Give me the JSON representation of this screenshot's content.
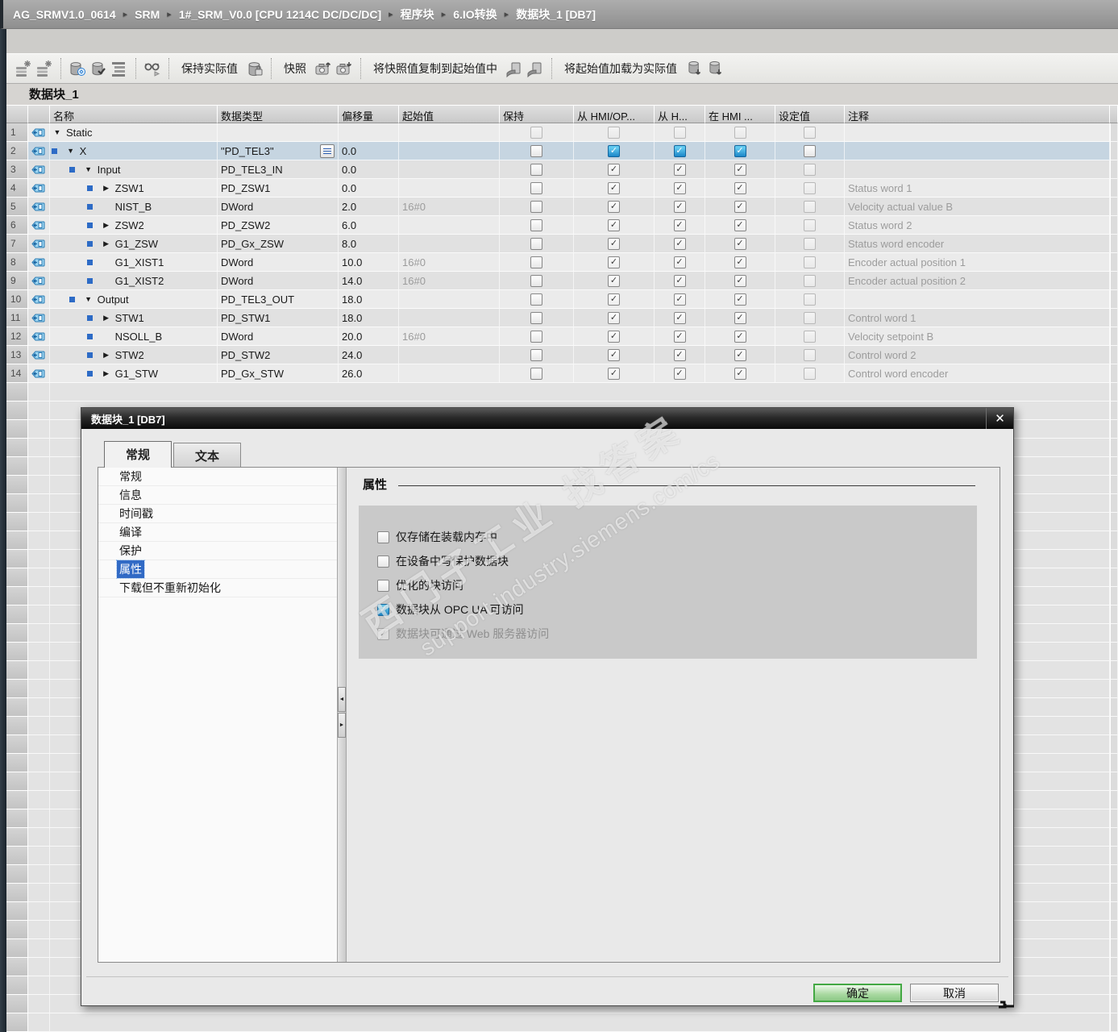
{
  "breadcrumb": {
    "items": [
      "AG_SRMV1.0_0614",
      "SRM",
      "1#_SRM_V0.0 [CPU 1214C DC/DC/DC]",
      "程序块",
      "6.IO转换",
      "数据块_1 [DB7]"
    ],
    "separator": "▸"
  },
  "toolbar": {
    "items": [
      {
        "type": "icon",
        "name": "insert-row-icon"
      },
      {
        "type": "icon",
        "name": "insert-row-below-icon"
      },
      {
        "type": "sep"
      },
      {
        "type": "icon",
        "name": "db-update-icon"
      },
      {
        "type": "icon",
        "name": "db-accept-icon"
      },
      {
        "type": "icon",
        "name": "outline-view-icon"
      },
      {
        "type": "sep"
      },
      {
        "type": "icon",
        "name": "monitor-glasses-icon"
      },
      {
        "type": "sep"
      },
      {
        "type": "button",
        "name": "retain-actual-values-button",
        "label": "保持实际值"
      },
      {
        "type": "icon",
        "name": "db-retain-icon"
      },
      {
        "type": "sep"
      },
      {
        "type": "button",
        "name": "snapshot-button",
        "label": "快照"
      },
      {
        "type": "icon",
        "name": "camera-up-icon"
      },
      {
        "type": "icon",
        "name": "camera-down-icon"
      },
      {
        "type": "sep"
      },
      {
        "type": "button",
        "name": "copy-snapshot-to-start-button",
        "label": "将快照值复制到起始值中"
      },
      {
        "type": "icon",
        "name": "copy-start-icon"
      },
      {
        "type": "icon",
        "name": "copy-start-all-icon"
      },
      {
        "type": "sep"
      },
      {
        "type": "button",
        "name": "load-start-as-actual-button",
        "label": "将起始值加载为实际值"
      },
      {
        "type": "icon",
        "name": "db-load-icon"
      },
      {
        "type": "icon",
        "name": "db-load-all-icon"
      }
    ]
  },
  "block_title": "数据块_1",
  "table": {
    "columns": [
      "",
      "",
      "名称",
      "数据类型",
      "偏移量",
      "起始值",
      "保持",
      "从 HMI/OP...",
      "从 H...",
      "在 HMI ...",
      "设定值",
      "注释",
      ""
    ],
    "filler_rows": 35,
    "rows": [
      {
        "num": 1,
        "indent": 0,
        "arrow": "down",
        "square": false,
        "name": "Static",
        "type": "",
        "type_button": false,
        "offset": "",
        "start": "",
        "retain": "off-dim",
        "hmi1": "off-dim",
        "hmi2": "off-dim",
        "hmi3": "off-dim",
        "setpoint": "off-dim",
        "comment": "",
        "selected": false,
        "shade": "light"
      },
      {
        "num": 2,
        "indent": 1,
        "arrow": "down",
        "square": true,
        "name": "X",
        "type": "\"PD_TEL3\"",
        "type_button": true,
        "offset": "0.0",
        "start": "",
        "retain": "off",
        "hmi1": "on-blue",
        "hmi2": "on-blue",
        "hmi3": "on-blue",
        "setpoint": "off",
        "comment": "",
        "selected": true,
        "shade": "light"
      },
      {
        "num": 3,
        "indent": 2,
        "arrow": "down",
        "square": true,
        "name": "Input",
        "type": "PD_TEL3_IN",
        "type_button": false,
        "offset": "0.0",
        "start": "",
        "retain": "off",
        "hmi1": "on-gray",
        "hmi2": "on-gray",
        "hmi3": "on-gray",
        "setpoint": "off-dim",
        "comment": "",
        "selected": false,
        "shade": "dark"
      },
      {
        "num": 4,
        "indent": 3,
        "arrow": "right",
        "square": true,
        "name": "ZSW1",
        "type": "PD_ZSW1",
        "type_button": false,
        "offset": "0.0",
        "start": "",
        "retain": "off",
        "hmi1": "on-gray",
        "hmi2": "on-gray",
        "hmi3": "on-gray",
        "setpoint": "off-dim",
        "comment": "Status word 1",
        "selected": false,
        "shade": "light"
      },
      {
        "num": 5,
        "indent": 3,
        "arrow": "",
        "square": true,
        "name": "NIST_B",
        "type": "DWord",
        "type_button": false,
        "offset": "2.0",
        "start": "16#0",
        "retain": "off",
        "hmi1": "on-gray",
        "hmi2": "on-gray",
        "hmi3": "on-gray",
        "setpoint": "off-dim",
        "comment": "Velocity actual value B",
        "selected": false,
        "shade": "dark"
      },
      {
        "num": 6,
        "indent": 3,
        "arrow": "right",
        "square": true,
        "name": "ZSW2",
        "type": "PD_ZSW2",
        "type_button": false,
        "offset": "6.0",
        "start": "",
        "retain": "off",
        "hmi1": "on-gray",
        "hmi2": "on-gray",
        "hmi3": "on-gray",
        "setpoint": "off-dim",
        "comment": "Status word 2",
        "selected": false,
        "shade": "light"
      },
      {
        "num": 7,
        "indent": 3,
        "arrow": "right",
        "square": true,
        "name": "G1_ZSW",
        "type": "PD_Gx_ZSW",
        "type_button": false,
        "offset": "8.0",
        "start": "",
        "retain": "off",
        "hmi1": "on-gray",
        "hmi2": "on-gray",
        "hmi3": "on-gray",
        "setpoint": "off-dim",
        "comment": "Status word encoder",
        "selected": false,
        "shade": "dark"
      },
      {
        "num": 8,
        "indent": 3,
        "arrow": "",
        "square": true,
        "name": "G1_XIST1",
        "type": "DWord",
        "type_button": false,
        "offset": "10.0",
        "start": "16#0",
        "retain": "off",
        "hmi1": "on-gray",
        "hmi2": "on-gray",
        "hmi3": "on-gray",
        "setpoint": "off-dim",
        "comment": "Encoder actual position 1",
        "selected": false,
        "shade": "light"
      },
      {
        "num": 9,
        "indent": 3,
        "arrow": "",
        "square": true,
        "name": "G1_XIST2",
        "type": "DWord",
        "type_button": false,
        "offset": "14.0",
        "start": "16#0",
        "retain": "off",
        "hmi1": "on-gray",
        "hmi2": "on-gray",
        "hmi3": "on-gray",
        "setpoint": "off-dim",
        "comment": "Encoder actual position 2",
        "selected": false,
        "shade": "dark"
      },
      {
        "num": 10,
        "indent": 2,
        "arrow": "down",
        "square": true,
        "name": "Output",
        "type": "PD_TEL3_OUT",
        "type_button": false,
        "offset": "18.0",
        "start": "",
        "retain": "off",
        "hmi1": "on-gray",
        "hmi2": "on-gray",
        "hmi3": "on-gray",
        "setpoint": "off-dim",
        "comment": "",
        "selected": false,
        "shade": "light"
      },
      {
        "num": 11,
        "indent": 3,
        "arrow": "right",
        "square": true,
        "name": "STW1",
        "type": "PD_STW1",
        "type_button": false,
        "offset": "18.0",
        "start": "",
        "retain": "off",
        "hmi1": "on-gray",
        "hmi2": "on-gray",
        "hmi3": "on-gray",
        "setpoint": "off-dim",
        "comment": "Control word 1",
        "selected": false,
        "shade": "dark"
      },
      {
        "num": 12,
        "indent": 3,
        "arrow": "",
        "square": true,
        "name": "NSOLL_B",
        "type": "DWord",
        "type_button": false,
        "offset": "20.0",
        "start": "16#0",
        "retain": "off",
        "hmi1": "on-gray",
        "hmi2": "on-gray",
        "hmi3": "on-gray",
        "setpoint": "off-dim",
        "comment": "Velocity setpoint B",
        "selected": false,
        "shade": "light"
      },
      {
        "num": 13,
        "indent": 3,
        "arrow": "right",
        "square": true,
        "name": "STW2",
        "type": "PD_STW2",
        "type_button": false,
        "offset": "24.0",
        "start": "",
        "retain": "off",
        "hmi1": "on-gray",
        "hmi2": "on-gray",
        "hmi3": "on-gray",
        "setpoint": "off-dim",
        "comment": "Control word 2",
        "selected": false,
        "shade": "dark"
      },
      {
        "num": 14,
        "indent": 3,
        "arrow": "right",
        "square": true,
        "name": "G1_STW",
        "type": "PD_Gx_STW",
        "type_button": false,
        "offset": "26.0",
        "start": "",
        "retain": "off",
        "hmi1": "on-gray",
        "hmi2": "on-gray",
        "hmi3": "on-gray",
        "setpoint": "off-dim",
        "comment": "Control word encoder",
        "selected": false,
        "shade": "light"
      }
    ]
  },
  "dialog": {
    "title": "数据块_1 [DB7]",
    "close_glyph": "✕",
    "tabs": [
      {
        "label": "常规",
        "active": true
      },
      {
        "label": "文本",
        "active": false
      }
    ],
    "nav": [
      {
        "label": "常规",
        "selected": false
      },
      {
        "label": "信息",
        "selected": false
      },
      {
        "label": "时间戳",
        "selected": false
      },
      {
        "label": "编译",
        "selected": false
      },
      {
        "label": "保护",
        "selected": false
      },
      {
        "label": "属性",
        "selected": true
      },
      {
        "label": "下载但不重新初始化",
        "selected": false
      }
    ],
    "section_title": "属性",
    "options": [
      {
        "label": "仅存储在装载内存中",
        "state": "off"
      },
      {
        "label": "在设备中写保护数据块",
        "state": "off"
      },
      {
        "label": "优化的块访问",
        "state": "off"
      },
      {
        "label": "数据块从 OPC UA 可访问",
        "state": "on"
      },
      {
        "label": "数据块可通过 Web 服务器访问",
        "state": "on-disabled"
      }
    ],
    "ok_label": "确定",
    "cancel_label": "取消"
  },
  "watermark": {
    "line1": "西门子工业 找答案",
    "line2": "support.industry.siemens.com/cs"
  },
  "colors": {
    "accent_blue": "#1b86c8",
    "selected_row": "#c6d5e1",
    "nav_selected": "#316ac5",
    "ok_green": "#43a843",
    "titlebar_dark": "#0a0a0a"
  }
}
